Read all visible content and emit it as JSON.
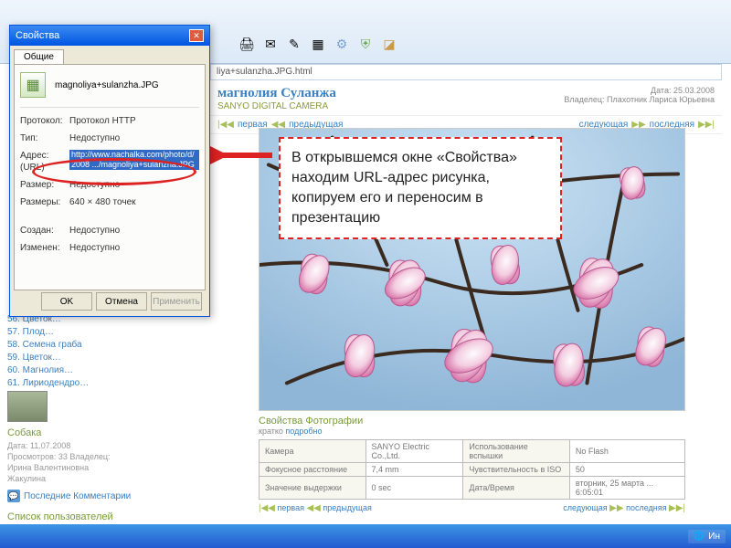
{
  "browser": {
    "url_suffix": "liya+sulanzha.JPG.html"
  },
  "dialog": {
    "title": "Свойства",
    "tab": "Общие",
    "filename": "magnoliya+sulanzha.JPG",
    "rows": {
      "protocol_label": "Протокол:",
      "protocol_value": "Протокол HTTP",
      "type_label": "Тип:",
      "type_value": "Недоступно",
      "url_label": "Адрес: (URL)",
      "url_value": "http://www.nachalka.com/photo/d/2008 .../magnoliya+sulanzha.JPG",
      "size_label": "Размер:",
      "size_value": "Недоступно",
      "dim_label": "Размеры:",
      "dim_value": "640 × 480 точек",
      "created_label": "Создан:",
      "created_value": "Недоступно",
      "modified_label": "Изменен:",
      "modified_value": "Недоступно"
    },
    "buttons": {
      "ok": "OK",
      "cancel": "Отмена",
      "apply": "Применить"
    }
  },
  "page": {
    "title": "магнолия Суланжа",
    "subtitle": "SANYO DIGITAL CAMERA",
    "date_label": "Дата: 25.03.2008",
    "owner_label": "Владелец: Плахотник Лариса Юрьевна",
    "nav": {
      "first": "первая",
      "prev": "предыдущая",
      "next": "следующая",
      "last": "последняя"
    }
  },
  "callout": {
    "text": "В открывшемся окне «Свойства» находим URL-адрес рисунка, копируем его и переносим в презентацию"
  },
  "sidebar": {
    "items": [
      "56. Цветок…",
      "57. Плод…",
      "58. Семена граба",
      "59. Цветок…",
      "60. Магнолия…",
      "61. Лириодендро…"
    ],
    "album_title": "Собака",
    "album_meta": "Дата: 11.07.2008\nПросмотров: 33 Владелец:\nИрина Валентиновна\nЖакулина",
    "recent": "Последние Комментарии",
    "users_title": "Список пользователей"
  },
  "photo_props": {
    "title": "Свойства Фотографии",
    "sub_prefix": "кратко ",
    "sub_link": "подробно",
    "rows": [
      [
        "Камера",
        "SANYO Electric Co.,Ltd.",
        "Использование вспышки",
        "No Flash"
      ],
      [
        "Фокусное расстояние",
        "7,4 mm",
        "Чувствительность в ISO",
        "50"
      ],
      [
        "Значение выдержки",
        "0 sec",
        "Дата/Время",
        "вторник, 25 марта ... 6:05:01"
      ]
    ]
  },
  "taskbar": {
    "item_right": "Ин"
  }
}
